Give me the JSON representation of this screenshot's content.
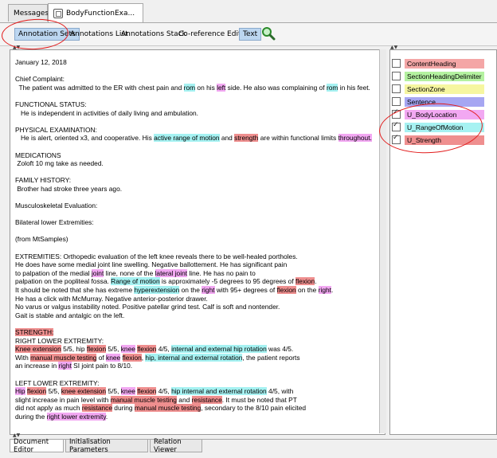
{
  "tabs": [
    {
      "label": "Messages"
    },
    {
      "label": "BodyFunctionExa..."
    }
  ],
  "toolbar": {
    "items": [
      "Annotation Sets",
      "Annotations List",
      "Annotations Stack",
      "Co-reference Editor",
      "Text"
    ]
  },
  "document": {
    "lines": [
      [
        {
          "t": "January 12, 2018"
        }
      ],
      [
        {
          "t": ""
        }
      ],
      [
        {
          "t": "Chief Complaint:"
        }
      ],
      [
        {
          "t": "  The patient was admitted to the ER with chest pain and "
        },
        {
          "t": "rom",
          "c": "rom"
        },
        {
          "t": " on his "
        },
        {
          "t": "left",
          "c": "body"
        },
        {
          "t": " side. He also was complaining of "
        },
        {
          "t": "rom",
          "c": "rom"
        },
        {
          "t": " in his feet."
        }
      ],
      [
        {
          "t": ""
        }
      ],
      [
        {
          "t": "FUNCTIONAL STATUS:"
        }
      ],
      [
        {
          "t": "   He is independent in activities of daily living and ambulation."
        }
      ],
      [
        {
          "t": ""
        }
      ],
      [
        {
          "t": "PHYSICAL EXAMINATION:"
        }
      ],
      [
        {
          "t": "   He is alert, oriented x3, and cooperative. His "
        },
        {
          "t": "active range of motion",
          "c": "rom"
        },
        {
          "t": " and "
        },
        {
          "t": "strength",
          "c": "str"
        },
        {
          "t": " are within functional limits "
        },
        {
          "t": "throughout.",
          "c": "body"
        }
      ],
      [
        {
          "t": ""
        }
      ],
      [
        {
          "t": "MEDICATIONS"
        }
      ],
      [
        {
          "t": " Zoloft 10 mg take as needed."
        }
      ],
      [
        {
          "t": ""
        }
      ],
      [
        {
          "t": "FAMILY HISTORY:"
        }
      ],
      [
        {
          "t": " Brother had stroke three years ago."
        }
      ],
      [
        {
          "t": ""
        }
      ],
      [
        {
          "t": "Musculoskeletal Evaluation:"
        }
      ],
      [
        {
          "t": ""
        }
      ],
      [
        {
          "t": "Bilateral lower Extremities:"
        }
      ],
      [
        {
          "t": ""
        }
      ],
      [
        {
          "t": "(from MtSamples)"
        }
      ],
      [
        {
          "t": ""
        }
      ],
      [
        {
          "t": "EXTREMITIES: Orthopedic evaluation of the left knee reveals there to be well-healed portholes."
        }
      ],
      [
        {
          "t": "He does have some medial joint line swelling. Negative ballottement. He has significant pain"
        }
      ],
      [
        {
          "t": "to palpation of the medial "
        },
        {
          "t": "joint",
          "c": "body"
        },
        {
          "t": " line, none of the "
        },
        {
          "t": "lateral joint",
          "c": "body"
        },
        {
          "t": " line. He has no pain to"
        }
      ],
      [
        {
          "t": "palpation on the popliteal fossa. "
        },
        {
          "t": "Range of motion",
          "c": "rom"
        },
        {
          "t": " is approximately -5 degrees to 95 degrees of "
        },
        {
          "t": "flexion",
          "c": "str"
        },
        {
          "t": "."
        }
      ],
      [
        {
          "t": "It should be noted that she has extreme "
        },
        {
          "t": "hyperextension",
          "c": "rom"
        },
        {
          "t": " on the "
        },
        {
          "t": "right",
          "c": "body"
        },
        {
          "t": " with 95+ degrees of "
        },
        {
          "t": "flexion",
          "c": "str"
        },
        {
          "t": " on the "
        },
        {
          "t": "right",
          "c": "body"
        },
        {
          "t": "."
        }
      ],
      [
        {
          "t": "He has a click with McMurray. Negative anterior-posterior drawer."
        }
      ],
      [
        {
          "t": "No varus or valgus instability noted. Positive patellar grind test. Calf is soft and nontender."
        }
      ],
      [
        {
          "t": "Gait is stable and antalgic on the left."
        }
      ],
      [
        {
          "t": ""
        }
      ],
      [
        {
          "t": "STRENGTH:",
          "c": "str"
        }
      ],
      [
        {
          "t": "RIGHT LOWER EXTREMITY:"
        }
      ],
      [
        {
          "t": "Knee extension",
          "c": "str"
        },
        {
          "t": " 5/5, hip "
        },
        {
          "t": "flexion",
          "c": "str"
        },
        {
          "t": " 5/5, "
        },
        {
          "t": "knee",
          "c": "body"
        },
        {
          "t": " "
        },
        {
          "t": "flexion",
          "c": "str"
        },
        {
          "t": " 4/5, "
        },
        {
          "t": "internal and external hip rotation",
          "c": "rom"
        },
        {
          "t": " was 4/5."
        }
      ],
      [
        {
          "t": "With "
        },
        {
          "t": "manual muscle testing",
          "c": "str"
        },
        {
          "t": " of "
        },
        {
          "t": "knee",
          "c": "body"
        },
        {
          "t": " "
        },
        {
          "t": "flexion",
          "c": "str"
        },
        {
          "t": ", "
        },
        {
          "t": "hip, internal and external rotation",
          "c": "rom"
        },
        {
          "t": ", the patient reports"
        }
      ],
      [
        {
          "t": "an increase in "
        },
        {
          "t": "right",
          "c": "body"
        },
        {
          "t": " SI joint pain to 8/10."
        }
      ],
      [
        {
          "t": ""
        }
      ],
      [
        {
          "t": "LEFT LOWER EXTREMITY:"
        }
      ],
      [
        {
          "t": "Hip",
          "c": "body"
        },
        {
          "t": " "
        },
        {
          "t": "flexion",
          "c": "str"
        },
        {
          "t": " 5/5, "
        },
        {
          "t": "knee extension",
          "c": "str"
        },
        {
          "t": " 5/5, "
        },
        {
          "t": "knee",
          "c": "body"
        },
        {
          "t": " "
        },
        {
          "t": "flexion",
          "c": "str"
        },
        {
          "t": " 4/5, "
        },
        {
          "t": "hip internal and external rotation",
          "c": "rom"
        },
        {
          "t": " 4/5, with"
        }
      ],
      [
        {
          "t": "slight increase in pain level with "
        },
        {
          "t": "manual muscle testing",
          "c": "str"
        },
        {
          "t": " and "
        },
        {
          "t": "resistance",
          "c": "str"
        },
        {
          "t": ". It must be noted that PT"
        }
      ],
      [
        {
          "t": "did not apply as much "
        },
        {
          "t": "resistance",
          "c": "str"
        },
        {
          "t": " during "
        },
        {
          "t": "manual muscle testing",
          "c": "str"
        },
        {
          "t": ", secondary to the 8/10 pain elicited"
        }
      ],
      [
        {
          "t": "during the "
        },
        {
          "t": "right lower extremity",
          "c": "body"
        },
        {
          "t": "."
        }
      ]
    ]
  },
  "annotation_types": [
    {
      "label": "ContentHeading",
      "checked": false,
      "color": "#f4a6a6"
    },
    {
      "label": "SectionHeadingDelimiter",
      "checked": false,
      "color": "#b4f2a0"
    },
    {
      "label": "SectionZone",
      "checked": false,
      "color": "#f6f6a0"
    },
    {
      "label": "Sentence",
      "checked": false,
      "color": "#a6a6f2"
    },
    {
      "label": "U_BodyLocation",
      "checked": true,
      "color": "#f2a8f2"
    },
    {
      "label": "U_RangeOfMotion",
      "checked": true,
      "color": "#a6f2f2"
    },
    {
      "label": "U_Strength",
      "checked": true,
      "color": "#ef8f8f"
    }
  ],
  "bottom_tabs": [
    {
      "label": "Document Editor"
    },
    {
      "label": "Initialisation Parameters"
    },
    {
      "label": "Relation Viewer"
    }
  ]
}
